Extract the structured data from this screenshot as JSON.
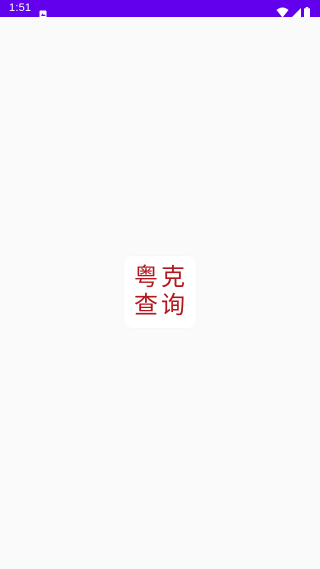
{
  "status_bar": {
    "time": "1:51",
    "background_color": "#6200ee",
    "icons": [
      "notification-icon",
      "wifi-icon",
      "signal-icon",
      "battery-icon"
    ]
  },
  "splash": {
    "logo_chars": [
      "粤",
      "克",
      "查",
      "询"
    ],
    "logo_color": "#b3161b",
    "background_color": "#fafafa"
  }
}
